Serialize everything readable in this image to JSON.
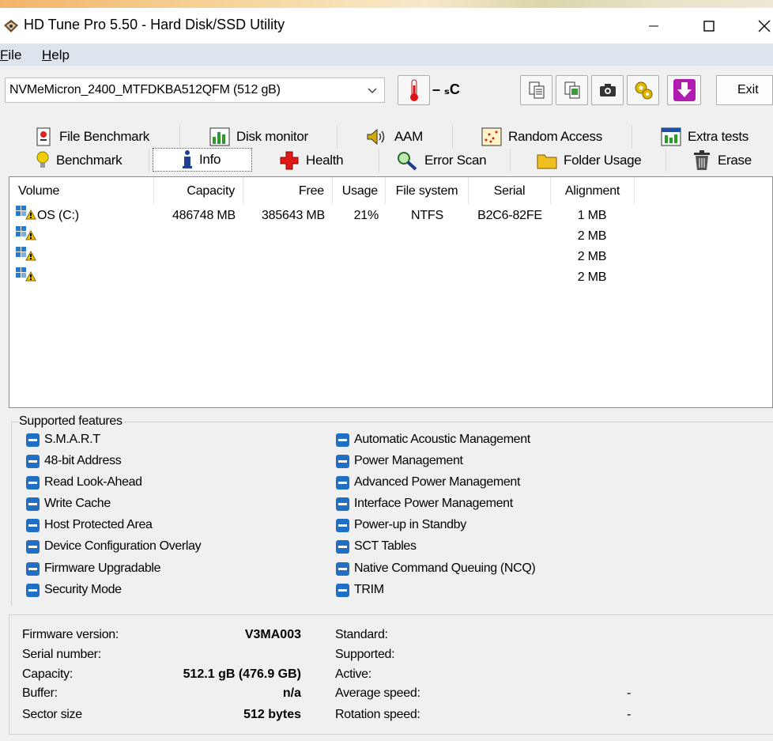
{
  "window": {
    "title": "HD Tune Pro 5.50 - Hard Disk/SSD Utility"
  },
  "menu": {
    "file": "File",
    "help": "Help"
  },
  "toolbar": {
    "drive": "NVMeMicron_2400_MTFDKBA512QFM (512 gB)",
    "temperature": "– ₛC",
    "exit": "Exit"
  },
  "tabs_row1": [
    {
      "label": "File Benchmark",
      "icon": "file-benchmark-icon"
    },
    {
      "label": "Disk monitor",
      "icon": "disk-monitor-icon"
    },
    {
      "label": "AAM",
      "icon": "speaker-icon"
    },
    {
      "label": "Random Access",
      "icon": "random-access-icon"
    },
    {
      "label": "Extra tests",
      "icon": "extra-tests-icon"
    }
  ],
  "tabs_row2": [
    {
      "label": "Benchmark",
      "icon": "lightbulb-icon"
    },
    {
      "label": "Info",
      "icon": "info-icon"
    },
    {
      "label": "Health",
      "icon": "health-cross-icon"
    },
    {
      "label": "Error Scan",
      "icon": "magnifier-icon"
    },
    {
      "label": "Folder Usage",
      "icon": "folder-icon"
    },
    {
      "label": "Erase",
      "icon": "trash-icon"
    }
  ],
  "volumes": {
    "headers": [
      "Volume",
      "Capacity",
      "Free",
      "Usage",
      "File system",
      "Serial",
      "Alignment"
    ],
    "rows": [
      {
        "volume": "OS (C:)",
        "capacity": "486748 MB",
        "free": "385643 MB",
        "usage": "21%",
        "fs": "NTFS",
        "serial": "B2C6-82FE",
        "alignment": "1 MB"
      },
      {
        "volume": "",
        "capacity": "",
        "free": "",
        "usage": "",
        "fs": "",
        "serial": "",
        "alignment": "2 MB"
      },
      {
        "volume": "",
        "capacity": "",
        "free": "",
        "usage": "",
        "fs": "",
        "serial": "",
        "alignment": "2 MB"
      },
      {
        "volume": "",
        "capacity": "",
        "free": "",
        "usage": "",
        "fs": "",
        "serial": "",
        "alignment": "2 MB"
      }
    ]
  },
  "features": {
    "label": "Supported features",
    "left": [
      "S.M.A.R.T",
      "48-bit Address",
      "Read Look-Ahead",
      "Write Cache",
      "Host Protected Area",
      "Device Configuration Overlay",
      "Firmware Upgradable",
      "Security Mode"
    ],
    "right": [
      "Automatic Acoustic Management",
      "Power Management",
      "Advanced Power Management",
      "Interface Power Management",
      "Power-up in Standby",
      "SCT Tables",
      "Native Command Queuing (NCQ)",
      "TRIM"
    ]
  },
  "info": {
    "firmware_label": "Firmware version:",
    "firmware": "V3MA003",
    "serial_label": "Serial number:",
    "serial": "",
    "capacity_label": "Capacity:",
    "capacity": "512.1 gB (476.9 GB)",
    "buffer_label": "Buffer:",
    "buffer": "n/a",
    "sector_label": "Sector size",
    "sector": "512 bytes",
    "standard_label": "Standard:",
    "standard": "",
    "supported_label": "Supported:",
    "supported": "",
    "active_label": "Active:",
    "active": "",
    "avg_speed_label": "Average speed:",
    "avg_speed": "-",
    "rotation_label": "Rotation speed:",
    "rotation": "-"
  }
}
